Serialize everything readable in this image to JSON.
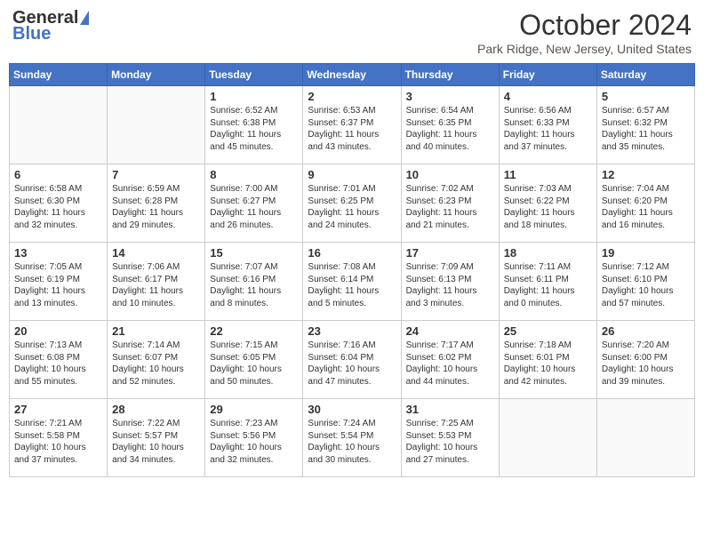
{
  "header": {
    "logo_general": "General",
    "logo_blue": "Blue",
    "month_title": "October 2024",
    "location": "Park Ridge, New Jersey, United States"
  },
  "days_of_week": [
    "Sunday",
    "Monday",
    "Tuesday",
    "Wednesday",
    "Thursday",
    "Friday",
    "Saturday"
  ],
  "weeks": [
    [
      {
        "day": "",
        "content": ""
      },
      {
        "day": "",
        "content": ""
      },
      {
        "day": "1",
        "content": "Sunrise: 6:52 AM\nSunset: 6:38 PM\nDaylight: 11 hours\nand 45 minutes."
      },
      {
        "day": "2",
        "content": "Sunrise: 6:53 AM\nSunset: 6:37 PM\nDaylight: 11 hours\nand 43 minutes."
      },
      {
        "day": "3",
        "content": "Sunrise: 6:54 AM\nSunset: 6:35 PM\nDaylight: 11 hours\nand 40 minutes."
      },
      {
        "day": "4",
        "content": "Sunrise: 6:56 AM\nSunset: 6:33 PM\nDaylight: 11 hours\nand 37 minutes."
      },
      {
        "day": "5",
        "content": "Sunrise: 6:57 AM\nSunset: 6:32 PM\nDaylight: 11 hours\nand 35 minutes."
      }
    ],
    [
      {
        "day": "6",
        "content": "Sunrise: 6:58 AM\nSunset: 6:30 PM\nDaylight: 11 hours\nand 32 minutes."
      },
      {
        "day": "7",
        "content": "Sunrise: 6:59 AM\nSunset: 6:28 PM\nDaylight: 11 hours\nand 29 minutes."
      },
      {
        "day": "8",
        "content": "Sunrise: 7:00 AM\nSunset: 6:27 PM\nDaylight: 11 hours\nand 26 minutes."
      },
      {
        "day": "9",
        "content": "Sunrise: 7:01 AM\nSunset: 6:25 PM\nDaylight: 11 hours\nand 24 minutes."
      },
      {
        "day": "10",
        "content": "Sunrise: 7:02 AM\nSunset: 6:23 PM\nDaylight: 11 hours\nand 21 minutes."
      },
      {
        "day": "11",
        "content": "Sunrise: 7:03 AM\nSunset: 6:22 PM\nDaylight: 11 hours\nand 18 minutes."
      },
      {
        "day": "12",
        "content": "Sunrise: 7:04 AM\nSunset: 6:20 PM\nDaylight: 11 hours\nand 16 minutes."
      }
    ],
    [
      {
        "day": "13",
        "content": "Sunrise: 7:05 AM\nSunset: 6:19 PM\nDaylight: 11 hours\nand 13 minutes."
      },
      {
        "day": "14",
        "content": "Sunrise: 7:06 AM\nSunset: 6:17 PM\nDaylight: 11 hours\nand 10 minutes."
      },
      {
        "day": "15",
        "content": "Sunrise: 7:07 AM\nSunset: 6:16 PM\nDaylight: 11 hours\nand 8 minutes."
      },
      {
        "day": "16",
        "content": "Sunrise: 7:08 AM\nSunset: 6:14 PM\nDaylight: 11 hours\nand 5 minutes."
      },
      {
        "day": "17",
        "content": "Sunrise: 7:09 AM\nSunset: 6:13 PM\nDaylight: 11 hours\nand 3 minutes."
      },
      {
        "day": "18",
        "content": "Sunrise: 7:11 AM\nSunset: 6:11 PM\nDaylight: 11 hours\nand 0 minutes."
      },
      {
        "day": "19",
        "content": "Sunrise: 7:12 AM\nSunset: 6:10 PM\nDaylight: 10 hours\nand 57 minutes."
      }
    ],
    [
      {
        "day": "20",
        "content": "Sunrise: 7:13 AM\nSunset: 6:08 PM\nDaylight: 10 hours\nand 55 minutes."
      },
      {
        "day": "21",
        "content": "Sunrise: 7:14 AM\nSunset: 6:07 PM\nDaylight: 10 hours\nand 52 minutes."
      },
      {
        "day": "22",
        "content": "Sunrise: 7:15 AM\nSunset: 6:05 PM\nDaylight: 10 hours\nand 50 minutes."
      },
      {
        "day": "23",
        "content": "Sunrise: 7:16 AM\nSunset: 6:04 PM\nDaylight: 10 hours\nand 47 minutes."
      },
      {
        "day": "24",
        "content": "Sunrise: 7:17 AM\nSunset: 6:02 PM\nDaylight: 10 hours\nand 44 minutes."
      },
      {
        "day": "25",
        "content": "Sunrise: 7:18 AM\nSunset: 6:01 PM\nDaylight: 10 hours\nand 42 minutes."
      },
      {
        "day": "26",
        "content": "Sunrise: 7:20 AM\nSunset: 6:00 PM\nDaylight: 10 hours\nand 39 minutes."
      }
    ],
    [
      {
        "day": "27",
        "content": "Sunrise: 7:21 AM\nSunset: 5:58 PM\nDaylight: 10 hours\nand 37 minutes."
      },
      {
        "day": "28",
        "content": "Sunrise: 7:22 AM\nSunset: 5:57 PM\nDaylight: 10 hours\nand 34 minutes."
      },
      {
        "day": "29",
        "content": "Sunrise: 7:23 AM\nSunset: 5:56 PM\nDaylight: 10 hours\nand 32 minutes."
      },
      {
        "day": "30",
        "content": "Sunrise: 7:24 AM\nSunset: 5:54 PM\nDaylight: 10 hours\nand 30 minutes."
      },
      {
        "day": "31",
        "content": "Sunrise: 7:25 AM\nSunset: 5:53 PM\nDaylight: 10 hours\nand 27 minutes."
      },
      {
        "day": "",
        "content": ""
      },
      {
        "day": "",
        "content": ""
      }
    ]
  ]
}
